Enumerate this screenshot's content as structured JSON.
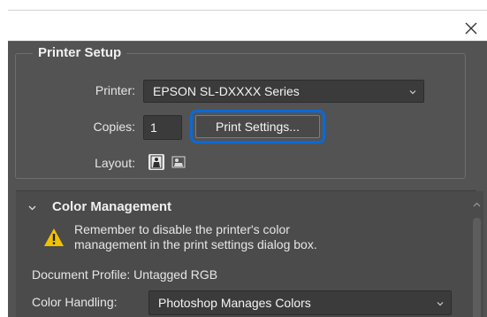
{
  "icons": {
    "close": "close-icon",
    "printer_chevron": "chevron-down-icon",
    "layout_portrait": "portrait-orientation-icon",
    "layout_landscape": "landscape-orientation-icon",
    "section_chevron": "chevron-down-icon",
    "warning": "warning-icon",
    "handling_chevron": "chevron-down-icon",
    "scroll_up": "scroll-up-arrow-icon"
  },
  "colors": {
    "dialog_bg": "#535353",
    "panel_bg": "#4b4b4b",
    "field_bg": "#3b3b3b",
    "focus_ring": "#0a6ad6",
    "warning_yellow": "#f2c200"
  },
  "printer_setup": {
    "title": "Printer Setup",
    "printer_label": "Printer:",
    "printer_value": "EPSON SL-DXXXX Series",
    "copies_label": "Copies:",
    "copies_value": "1",
    "print_settings_label": "Print Settings...",
    "layout_label": "Layout:"
  },
  "color_management": {
    "title": "Color Management",
    "warning_text": "Remember to disable the printer's color management in the print settings dialog box.",
    "document_profile": "Document Profile: Untagged RGB",
    "color_handling_label": "Color Handling:",
    "color_handling_value": "Photoshop Manages Colors"
  }
}
